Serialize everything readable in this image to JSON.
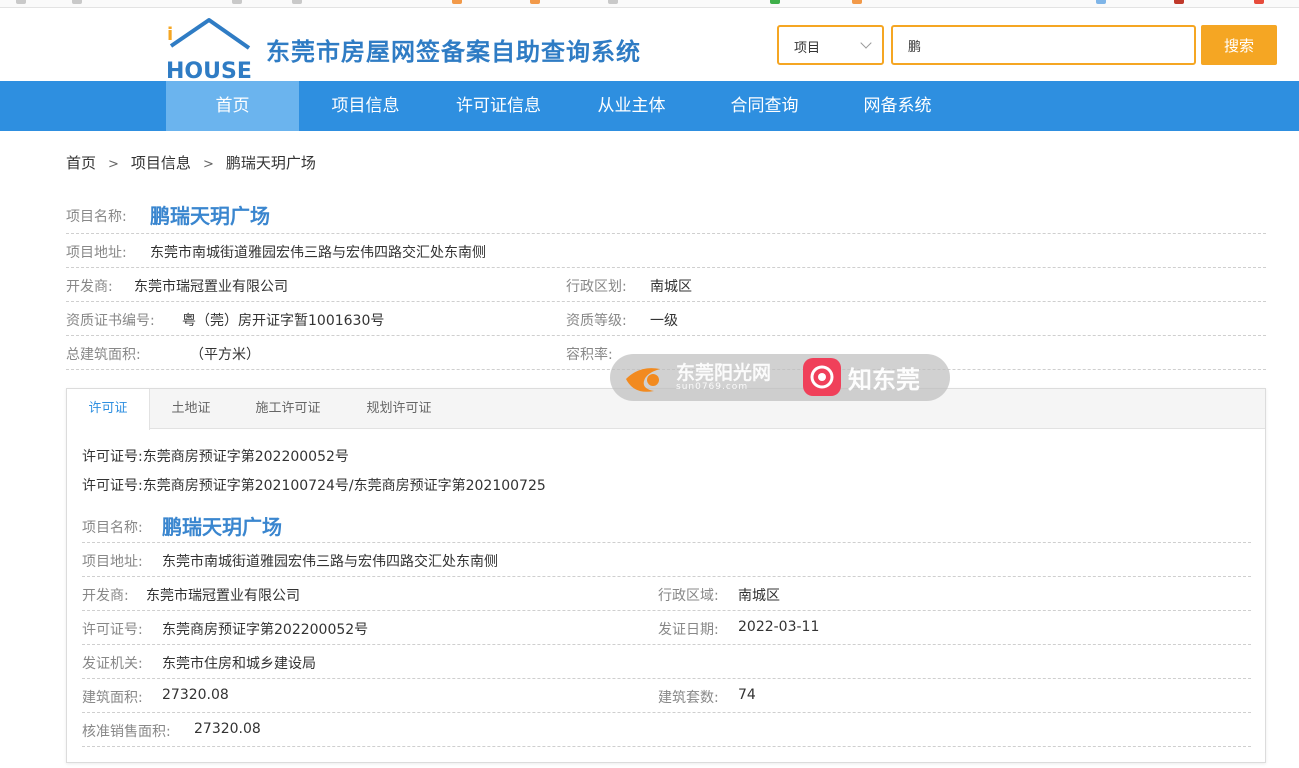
{
  "header": {
    "site_title": "东莞市房屋网签备案自助查询系统",
    "logo_text": "HOUSE",
    "logo_i": "i",
    "search_type": "项目",
    "search_value": "鹏",
    "search_button": "搜索"
  },
  "nav": {
    "items": [
      "首页",
      "项目信息",
      "许可证信息",
      "从业主体",
      "合同查询",
      "网备系统"
    ]
  },
  "breadcrumb": [
    "首页",
    "项目信息",
    "鹏瑞天玥广场"
  ],
  "breadcrumb_sep": ">",
  "project": {
    "name_label": "项目名称:",
    "name": "鹏瑞天玥广场",
    "address_label": "项目地址:",
    "address": "东莞市南城街道雅园宏伟三路与宏伟四路交汇处东南侧",
    "developer_label": "开发商:",
    "developer": "东莞市瑞冠置业有限公司",
    "district_label": "行政区划:",
    "district": "南城区",
    "cert_no_label": "资质证书编号:",
    "cert_no": "粤（莞）房开证字暂1001630号",
    "cert_level_label": "资质等级:",
    "cert_level": "一级",
    "area_label": "总建筑面积:",
    "area_unit": "（平方米）",
    "far_label": "容积率:"
  },
  "watermark": {
    "brand1": "东莞阳光网",
    "brand1_sub": "sun0769.com",
    "brand2": "知东莞"
  },
  "tabs": [
    "许可证",
    "土地证",
    "施工许可证",
    "规划许可证"
  ],
  "license": {
    "permits": [
      {
        "label": "许可证号:",
        "value": "东莞商房预证字第202200052号"
      },
      {
        "label": "许可证号:",
        "value": "东莞商房预证字第202100724号/东莞商房预证字第202100725"
      }
    ],
    "name_label": "项目名称:",
    "name": "鹏瑞天玥广场",
    "address_label": "项目地址:",
    "address": "东莞市南城街道雅园宏伟三路与宏伟四路交汇处东南侧",
    "developer_label": "开发商:",
    "developer": "东莞市瑞冠置业有限公司",
    "district_label": "行政区域:",
    "district": "南城区",
    "permit_no_label": "许可证号:",
    "permit_no": "东莞商房预证字第202200052号",
    "issue_date_label": "发证日期:",
    "issue_date": "2022-03-11",
    "authority_label": "发证机关:",
    "authority": "东莞市住房和城乡建设局",
    "build_area_label": "建筑面积:",
    "build_area": "27320.08",
    "units_label": "建筑套数:",
    "units": "74",
    "sale_area_label": "核准销售面积:",
    "sale_area": "27320.08"
  },
  "colors": {
    "brand_blue": "#2e8fe0",
    "accent_orange": "#f5a623",
    "nav_active": "#6bb4ee"
  }
}
